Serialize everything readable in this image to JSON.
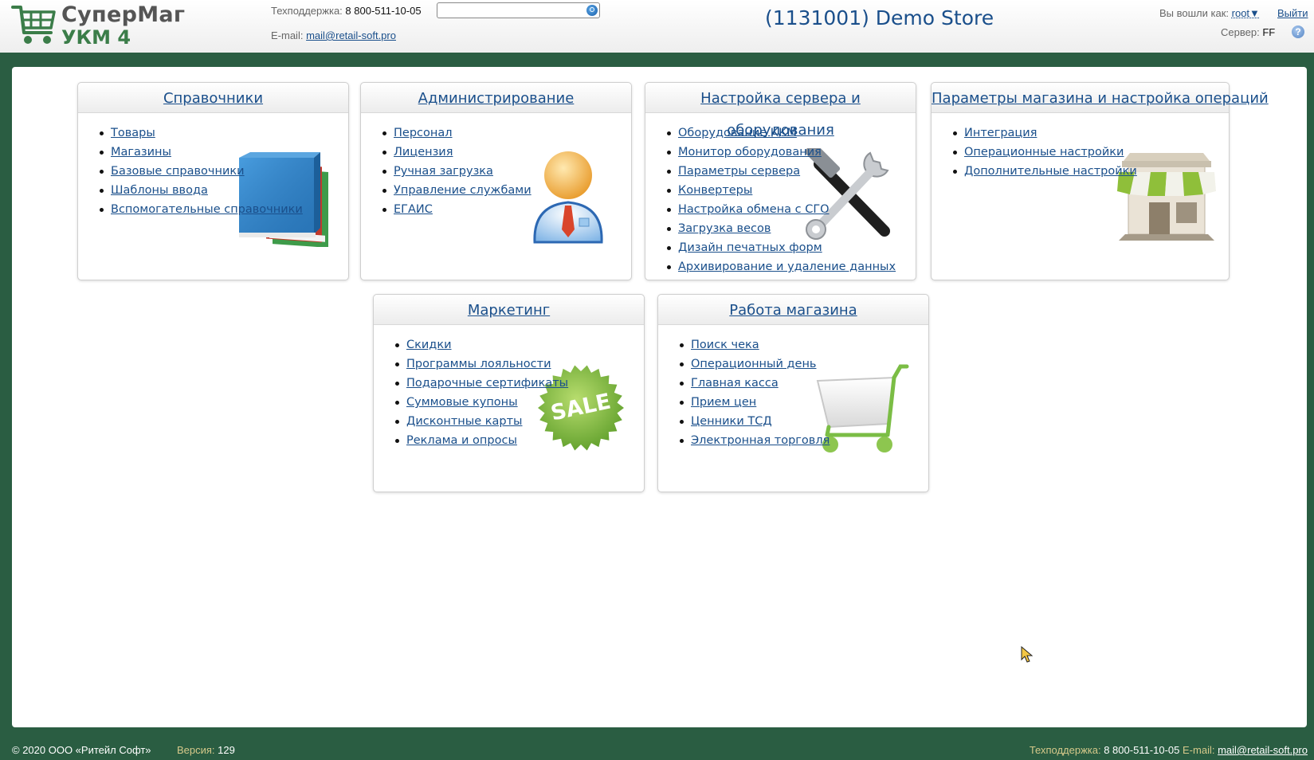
{
  "brand": {
    "name": "СуперМаг",
    "product": "УКМ 4",
    "logo_icon": "shopping-cart-icon"
  },
  "header": {
    "support_label": "Техподдержка:",
    "support_phone": "8 800-511-10-05",
    "email_label": "E-mail:",
    "email": "mail@retail-soft.pro",
    "search_placeholder": "",
    "store_title": "(1131001) Demo Store",
    "logged_label": "Вы вошли как:",
    "user": "root▼",
    "logout": "Выйти",
    "server_label": "Сервер:",
    "server_value": "FF",
    "help": "?"
  },
  "cards": {
    "dict": {
      "title": "Справочники",
      "icon": "books-icon",
      "items": [
        "Товары",
        "Магазины",
        "Базовые справочники",
        "Шаблоны ввода",
        "Вспомогательные справочники"
      ]
    },
    "admin": {
      "title": "Администрирование",
      "icon": "user-admin-icon",
      "items": [
        "Персонал",
        "Лицензия",
        "Ручная загрузка",
        "Управление службами",
        "ЕГАИС"
      ]
    },
    "server": {
      "title": "Настройка сервера и оборудования",
      "icon": "tools-icon",
      "items": [
        "Оборудование ККМ",
        "Монитор оборудования",
        "Параметры сервера",
        "Конвертеры",
        "Настройка обмена с СГО",
        "Загрузка весов",
        "Дизайн печатных форм",
        "Архивирование и удаление данных"
      ]
    },
    "store": {
      "title": "Параметры магазина и настройка операций",
      "icon": "storefront-icon",
      "items": [
        "Интеграция",
        "Операционные настройки",
        "Дополнительные настройки"
      ]
    },
    "marketing": {
      "title": "Маркетинг",
      "icon": "sale-badge-icon",
      "badge": "SALE",
      "items": [
        "Скидки",
        "Программы лояльности",
        "Подарочные сертификаты",
        "Суммовые купоны",
        "Дисконтные карты",
        "Реклама и опросы"
      ]
    },
    "shop": {
      "title": "Работа магазина",
      "icon": "shopping-cart-icon",
      "items": [
        "Поиск чека",
        "Операционный день",
        "Главная касса",
        "Прием цен",
        "Ценники ТСД",
        "Электронная торговля"
      ]
    }
  },
  "footer": {
    "copyright": "© 2020 ООО «Ритейл Софт»",
    "version_label": "Версия:",
    "version": "129",
    "support_label": "Техподдержка:",
    "support_phone": "8 800-511-10-05",
    "email_label": "E-mail:",
    "email": "mail@retail-soft.pro"
  }
}
